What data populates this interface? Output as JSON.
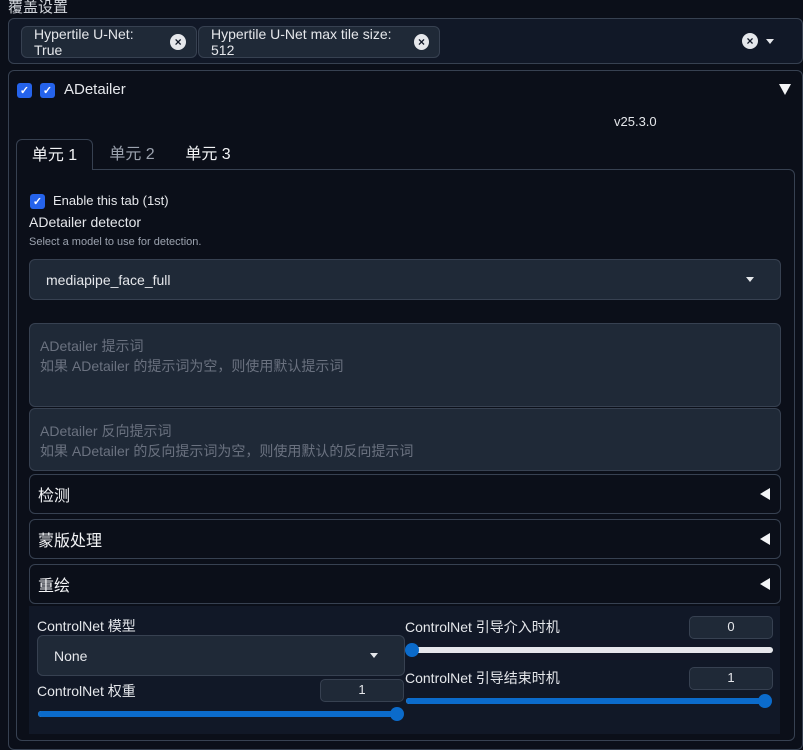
{
  "override": {
    "title": "覆盖设置",
    "chips": [
      {
        "label": "Hypertile U-Net: True"
      },
      {
        "label": "Hypertile U-Net max tile size: 512"
      }
    ],
    "clear_glyph": "×"
  },
  "adetailer": {
    "enabled": true,
    "title": "ADetailer",
    "version": "v25.3.0",
    "tabs": [
      {
        "label": "单元 1",
        "active": true
      },
      {
        "label": "单元 2",
        "active": false
      },
      {
        "label": "单元 3",
        "active": false
      }
    ],
    "enable_tab_label": "Enable this tab (1st)",
    "detector_label": "ADetailer detector",
    "detector_info": "Select a model to use for detection.",
    "detector_value": "mediapipe_face_full",
    "prompt_label": "ADetailer 提示词",
    "prompt_placeholder": "如果 ADetailer 的提示词为空，则使用默认提示词",
    "negative_label": "ADetailer 反向提示词",
    "negative_placeholder": "如果 ADetailer 的反向提示词为空，则使用默认的反向提示词",
    "accordions": [
      "检测",
      "蒙版处理",
      "重绘"
    ],
    "controlnet": {
      "model_label": "ControlNet 模型",
      "model_value": "None",
      "weight_label": "ControlNet 权重",
      "weight_value": "1",
      "weight_fraction": 1.0,
      "start_label": "ControlNet 引导介入时机",
      "start_value": "0",
      "start_fraction": 0.0,
      "end_label": "ControlNet 引导结束时机",
      "end_value": "1",
      "end_fraction": 1.0
    }
  },
  "colors": {
    "accent": "#2563eb",
    "slider": "#0b6bcb",
    "background": "#0b0f19",
    "input": "#1f2937"
  },
  "icons": {
    "check": "✓",
    "clear": "close-icon",
    "collapse": "triangle-down-icon",
    "expand": "triangle-left-icon"
  }
}
